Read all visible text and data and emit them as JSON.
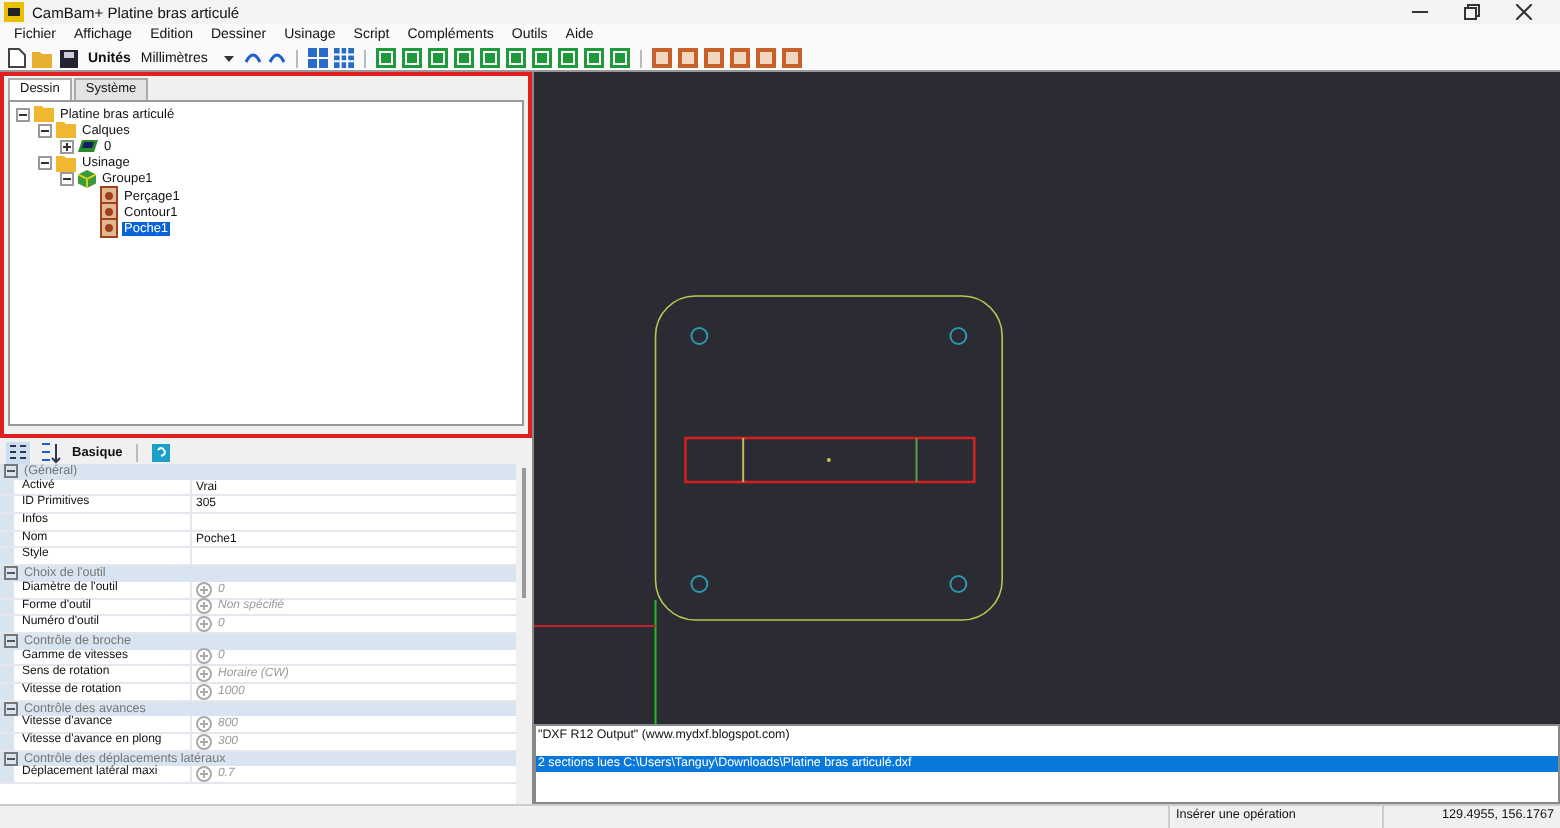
{
  "window": {
    "title": "CamBam+  Platine bras articulé"
  },
  "menu": [
    "Fichier",
    "Affichage",
    "Edition",
    "Dessiner",
    "Usinage",
    "Script",
    "Compléments",
    "Outils",
    "Aide"
  ],
  "toolbar": {
    "units_label": "Unités",
    "units_value": "Millimètres"
  },
  "tabs": [
    {
      "label": "Dessin",
      "selected": true
    },
    {
      "label": "Système",
      "selected": false
    }
  ],
  "tree": [
    {
      "label": "Platine bras articulé",
      "kind": "folder",
      "expanded": true,
      "selected": false,
      "children": [
        {
          "label": "Calques",
          "kind": "folder",
          "expanded": true,
          "selected": false,
          "children": [
            {
              "label": "0",
              "kind": "layer",
              "expanded": false,
              "selected": false
            }
          ]
        },
        {
          "label": "Usinage",
          "kind": "folder",
          "expanded": true,
          "selected": false,
          "children": [
            {
              "label": "Groupe1",
              "kind": "group",
              "expanded": true,
              "selected": false,
              "children": [
                {
                  "label": "Perçage1",
                  "kind": "op",
                  "selected": false
                },
                {
                  "label": "Contour1",
                  "kind": "op",
                  "selected": false
                },
                {
                  "label": "Poche1",
                  "kind": "op",
                  "selected": true
                }
              ]
            }
          ]
        }
      ]
    }
  ],
  "properties_toolbar": {
    "label": "Basique"
  },
  "properties": [
    {
      "section": "(Général)",
      "expanded": true,
      "rows": [
        {
          "name": "Activé",
          "value": "Vrai",
          "default": false
        },
        {
          "name": "ID Primitives",
          "value": "305",
          "default": false
        },
        {
          "name": "Infos",
          "default": false
        },
        {
          "name": "Nom",
          "value": "Poche1",
          "default": false
        },
        {
          "name": "Style",
          "default": false
        }
      ]
    },
    {
      "section": "Choix de l'outil",
      "expanded": true,
      "rows": [
        {
          "name": "Diamètre de l'outil",
          "value": "0",
          "default": true
        },
        {
          "name": "Forme d'outil",
          "value": "Non spécifié",
          "default": true
        },
        {
          "name": "Numéro d'outil",
          "value": "0",
          "default": true
        }
      ]
    },
    {
      "section": "Contrôle de broche",
      "expanded": true,
      "rows": [
        {
          "name": "Gamme de vitesses",
          "value": "0",
          "default": true
        },
        {
          "name": "Sens de rotation",
          "value": "Horaire (CW)",
          "default": true
        },
        {
          "name": "Vitesse de rotation",
          "value": "1000",
          "default": true
        }
      ]
    },
    {
      "section": "Contrôle des avances",
      "expanded": true,
      "rows": [
        {
          "name": "Vitesse d'avance",
          "value": "800",
          "default": true
        },
        {
          "name": "Vitesse d'avance en plong",
          "value": "300",
          "default": true
        }
      ]
    },
    {
      "section": "Contrôle des déplacements latéraux",
      "expanded": true,
      "rows": [
        {
          "name": "Déplacement latéral maxi",
          "value": "0.7",
          "default": true
        }
      ]
    }
  ],
  "output": [
    {
      "text": "\"DXF R12 Output\" (www.mydxf.blogspot.com)",
      "selected": false
    },
    {
      "text": "2 sections lues C:\\Users\\Tanguy\\Downloads\\Platine bras articulé.dxf",
      "selected": true
    }
  ],
  "status_bar": {
    "message": "Insérer une opération",
    "coordinates": "129.4955, 156.1767"
  }
}
